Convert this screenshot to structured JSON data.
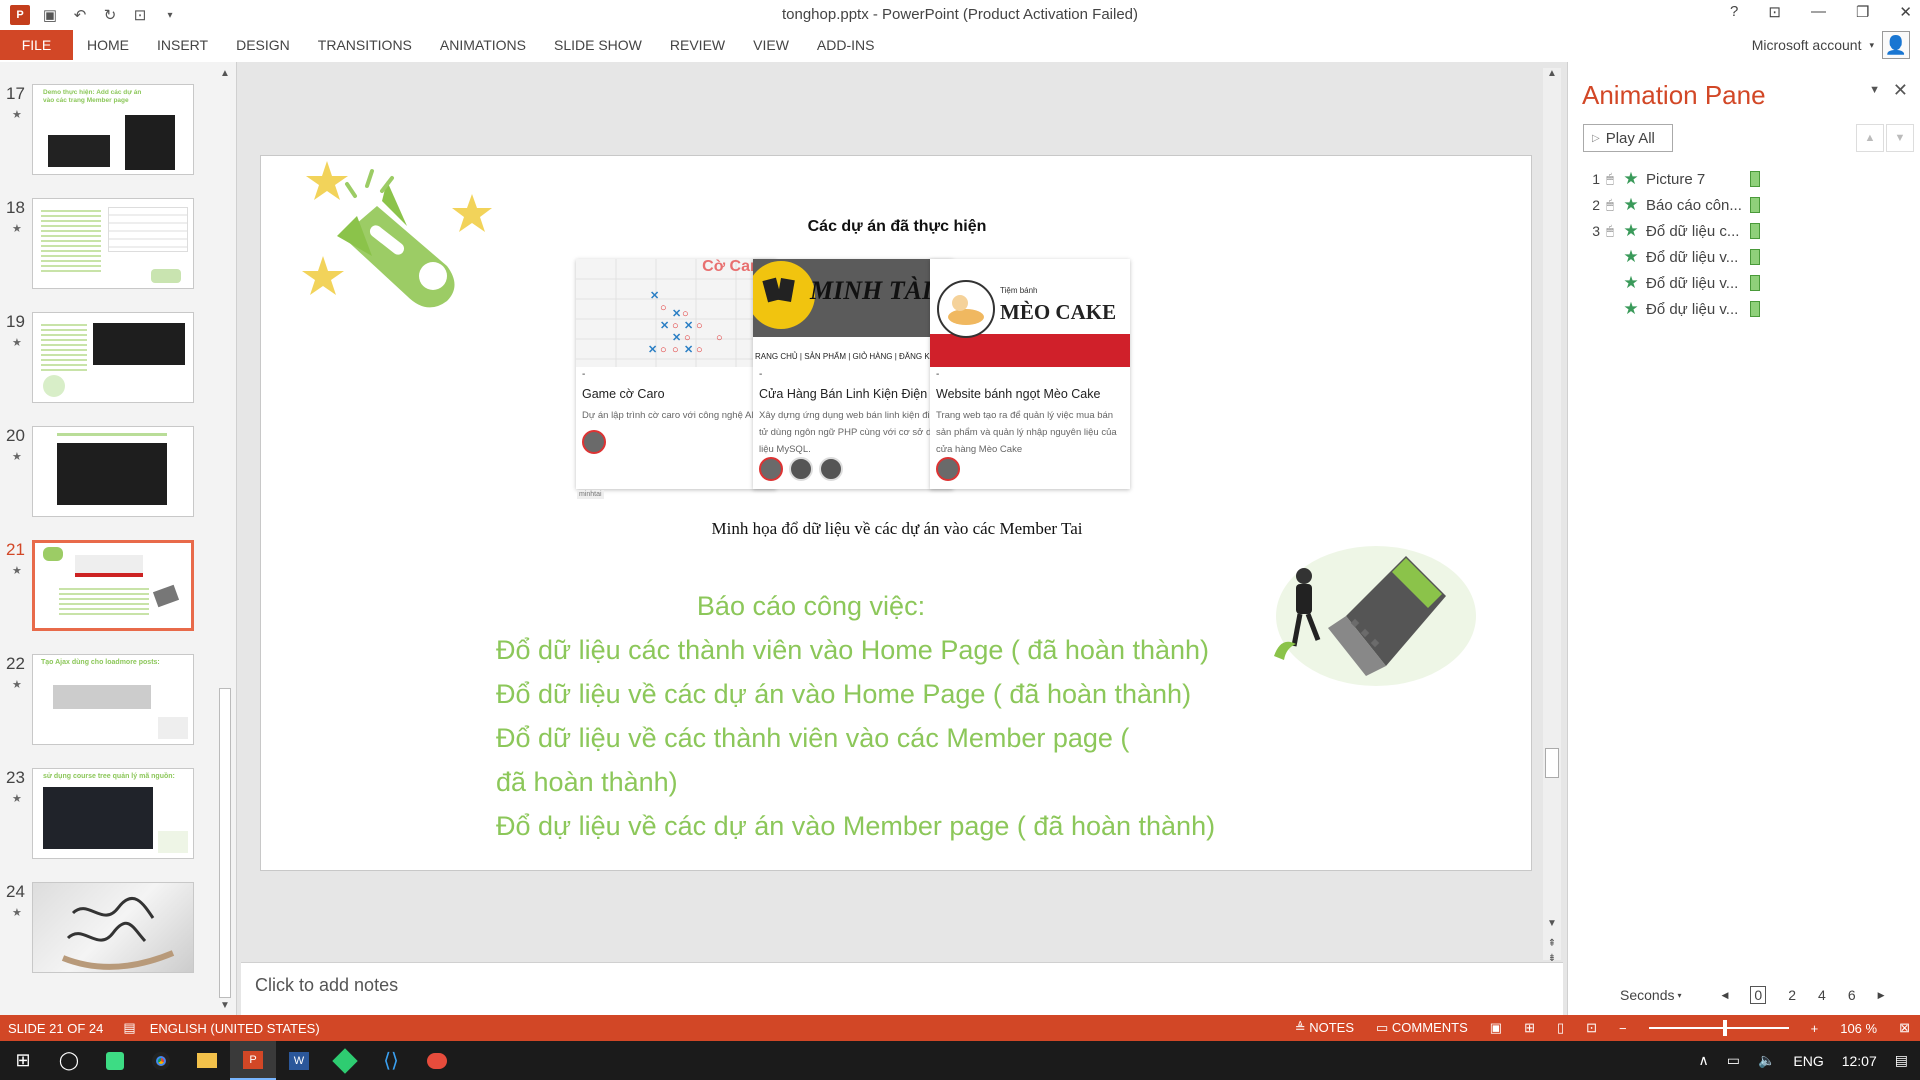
{
  "titlebar": {
    "title": "tonghop.pptx - PowerPoint (Product Activation Failed)",
    "help": "?",
    "qat_logo": "P",
    "qat_save": "▣",
    "qat_undo": "↶",
    "qat_redo": "↻",
    "qat_present": "⊡",
    "qat_more": "▾",
    "ctrl_ribbon": "⊡",
    "ctrl_min": "—",
    "ctrl_max": "❐",
    "ctrl_close": "✕"
  },
  "ribbon": {
    "file": "FILE",
    "tabs": [
      "HOME",
      "INSERT",
      "DESIGN",
      "TRANSITIONS",
      "ANIMATIONS",
      "SLIDE SHOW",
      "REVIEW",
      "VIEW",
      "ADD-INS"
    ],
    "account": "Microsoft account",
    "account_caret": "▾",
    "avatar_glyph": "👤"
  },
  "thumbnails": {
    "star": "★",
    "items": [
      {
        "num": "17"
      },
      {
        "num": "18"
      },
      {
        "num": "19"
      },
      {
        "num": "20"
      },
      {
        "num": "21",
        "active": true
      },
      {
        "num": "22"
      },
      {
        "num": "23"
      },
      {
        "num": "24"
      }
    ],
    "t17_text": "Demo thực hiện: Add các dự án vào các trang Member page",
    "t22_text": "Tạo Ajax dùng cho loadmore posts:",
    "t23_text": "sử dụng course tree quản lý mã nguồn:"
  },
  "slide": {
    "projects_title": "Các dự án đã thực hiện",
    "cards": [
      {
        "brand": "Cờ Caro",
        "dash": "-",
        "title": "Game cờ Caro",
        "desc": "Dự án lập trình cờ caro với công nghệ AI."
      },
      {
        "brand": "MINH TÀI",
        "dash": "-",
        "title": "Cửa Hàng Bán Linh Kiện Điện Tử",
        "desc": "Xây dựng ứng dụng web bán linh kiện điện tử dùng ngôn ngữ PHP cùng với cơ sở dữ liệu MySQL.",
        "nav": "RANG CHỦ | SẢN PHẨM | GIỎ HÀNG | ĐĂNG KÍ"
      },
      {
        "brand": "MÈO CAKE",
        "brand_small": "Tiệm bánh",
        "dash": "-",
        "title": "Website bánh ngọt Mèo Cake",
        "desc": "Trang web tạo ra để quản lý việc mua bán sản phẩm và quản lý nhập nguyên liệu của cửa hàng Mèo Cake"
      }
    ],
    "minhtai_tag": "minhtai",
    "caption": "Minh họa đổ dữ liệu về các dự án vào các Member Tai",
    "report_head": "Báo cáo công việc:",
    "report_lines": [
      "Đổ dữ liệu các thành viên vào Home Page ( đã hoàn thành)",
      "Đổ dữ liệu về các dự án vào Home Page ( đã hoàn thành)",
      "Đổ dữ liệu về các thành viên vào các Member page ( đã hoàn thành)",
      "Đổ dự liệu về các dự án vào Member page ( đã hoàn thành)"
    ]
  },
  "notes": {
    "placeholder": "Click to add notes"
  },
  "animation_pane": {
    "title": "Animation Pane",
    "play_all": "Play All",
    "items": [
      {
        "n": "1",
        "label": "Picture 7",
        "mouse": true
      },
      {
        "n": "2",
        "label": "Báo cáo côn...",
        "mouse": true
      },
      {
        "n": "3",
        "label": "Đổ dữ liệu c...",
        "mouse": true
      },
      {
        "n": "",
        "label": "Đổ dữ liệu v...",
        "mouse": false
      },
      {
        "n": "",
        "label": "Đổ dữ liệu v...",
        "mouse": false
      },
      {
        "n": "",
        "label": "Đổ dự liệu v...",
        "mouse": false
      }
    ],
    "seconds": "Seconds",
    "scale": [
      "0",
      "2",
      "4",
      "6"
    ]
  },
  "status": {
    "slide": "SLIDE 21 OF 24",
    "language": "ENGLISH (UNITED STATES)",
    "notes": "NOTES",
    "comments": "COMMENTS",
    "zoom_minus": "−",
    "zoom_plus": "+",
    "zoom": "106 %"
  },
  "taskbar": {
    "lang": "ENG",
    "time": "12:07"
  },
  "colors": {
    "accent": "#d24726",
    "report_green": "#8cc75a",
    "anim_star": "#3a9a5a"
  }
}
